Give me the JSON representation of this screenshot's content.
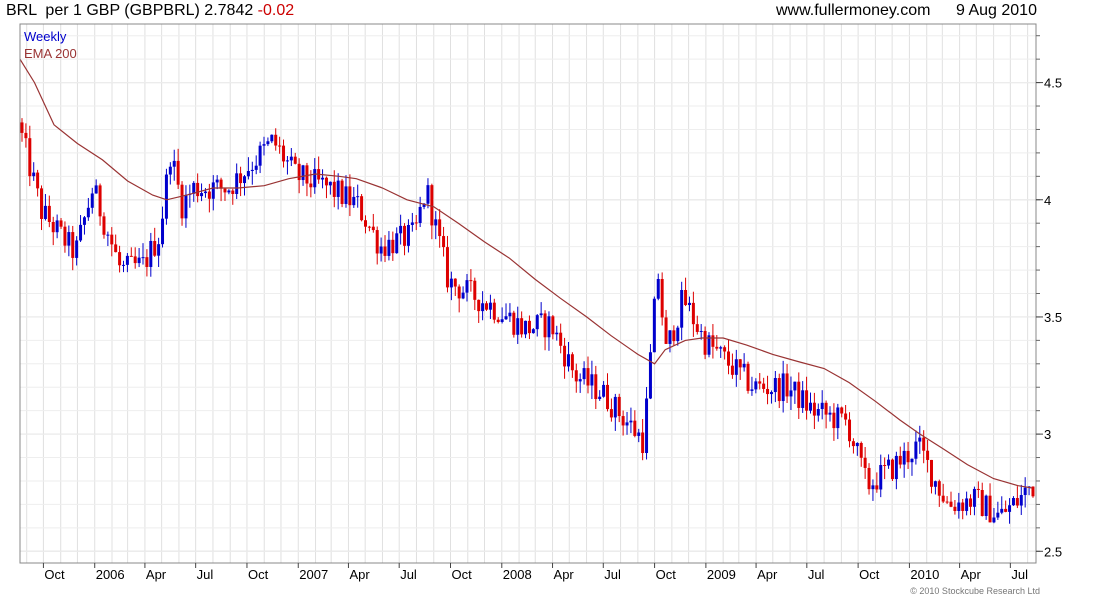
{
  "header": {
    "title": "BRL  per 1 GBP (GBPBRL) 2.7842",
    "change": " -0.02",
    "site": "www.fullermoney.com",
    "date": "9 Aug 2010"
  },
  "colors": {
    "up_candle": "#0000cc",
    "down_candle": "#dd0000",
    "ema_line": "#993333",
    "grid": "#cccccc",
    "frame": "#888888"
  },
  "copyright": "© 2010 Stockcube Research Ltd",
  "chart_data": {
    "type": "candlestick",
    "legend": [
      {
        "label": "Weekly",
        "color": "#0000cc"
      },
      {
        "label": "EMA 200",
        "color": "#993333"
      }
    ],
    "ylim": [
      2.45,
      4.75
    ],
    "y_ticks": [
      2.5,
      3,
      3.5,
      4,
      4.5
    ],
    "grid": true,
    "x_ticks": [
      "Oct",
      "2006",
      "Apr",
      "Jul",
      "Oct",
      "2007",
      "Apr",
      "Jul",
      "Oct",
      "2008",
      "Apr",
      "Jul",
      "Oct",
      "2009",
      "Apr",
      "Jul",
      "Oct",
      "2010",
      "Apr",
      "Jul"
    ],
    "x_range": [
      "2005-08-20",
      "2010-08-16"
    ],
    "series": [
      {
        "name": "Weekly",
        "kind": "candles",
        "anchors": [
          [
            "2005-08-20",
            4.33
          ],
          [
            "2005-10-01",
            3.95
          ],
          [
            "2005-12-01",
            3.77
          ],
          [
            "2006-01-01",
            4.05
          ],
          [
            "2006-02-20",
            3.7
          ],
          [
            "2006-04-01",
            3.72
          ],
          [
            "2006-05-01",
            3.85
          ],
          [
            "2006-05-20",
            4.2
          ],
          [
            "2006-06-10",
            3.98
          ],
          [
            "2006-07-01",
            4.05
          ],
          [
            "2006-09-01",
            4.05
          ],
          [
            "2006-11-20",
            4.25
          ],
          [
            "2007-01-01",
            4.1
          ],
          [
            "2007-03-01",
            4.05
          ],
          [
            "2007-04-20",
            3.98
          ],
          [
            "2007-06-01",
            3.8
          ],
          [
            "2007-08-01",
            3.85
          ],
          [
            "2007-08-22",
            4.05
          ],
          [
            "2007-10-01",
            3.65
          ],
          [
            "2007-12-15",
            3.55
          ],
          [
            "2008-02-15",
            3.45
          ],
          [
            "2008-04-01",
            3.47
          ],
          [
            "2008-05-15",
            3.25
          ],
          [
            "2008-07-01",
            3.18
          ],
          [
            "2008-09-15",
            2.97
          ],
          [
            "2008-10-10",
            3.7
          ],
          [
            "2008-10-25",
            3.35
          ],
          [
            "2008-11-25",
            3.58
          ],
          [
            "2009-01-01",
            3.4
          ],
          [
            "2009-02-15",
            3.3
          ],
          [
            "2009-04-01",
            3.2
          ],
          [
            "2009-06-01",
            3.2
          ],
          [
            "2009-07-15",
            3.1
          ],
          [
            "2009-09-15",
            3.05
          ],
          [
            "2009-10-20",
            2.78
          ],
          [
            "2009-12-01",
            2.85
          ],
          [
            "2010-01-20",
            2.95
          ],
          [
            "2010-02-20",
            2.8
          ],
          [
            "2010-03-15",
            2.7
          ],
          [
            "2010-05-01",
            2.72
          ],
          [
            "2010-06-15",
            2.65
          ],
          [
            "2010-07-20",
            2.72
          ],
          [
            "2010-08-09",
            2.78
          ]
        ]
      },
      {
        "name": "EMA 200",
        "kind": "line",
        "points": [
          [
            "2005-08-20",
            4.6
          ],
          [
            "2005-09-15",
            4.5
          ],
          [
            "2005-10-20",
            4.32
          ],
          [
            "2005-12-01",
            4.24
          ],
          [
            "2006-01-15",
            4.17
          ],
          [
            "2006-03-01",
            4.08
          ],
          [
            "2006-04-15",
            4.02
          ],
          [
            "2006-05-10",
            4.0
          ],
          [
            "2006-06-15",
            4.02
          ],
          [
            "2006-08-01",
            4.05
          ],
          [
            "2006-09-15",
            4.05
          ],
          [
            "2006-11-01",
            4.06
          ],
          [
            "2006-12-15",
            4.09
          ],
          [
            "2007-02-01",
            4.11
          ],
          [
            "2007-03-15",
            4.1
          ],
          [
            "2007-04-15",
            4.09
          ],
          [
            "2007-06-01",
            4.05
          ],
          [
            "2007-07-15",
            4.0
          ],
          [
            "2007-09-01",
            3.97
          ],
          [
            "2007-10-15",
            3.9
          ],
          [
            "2007-12-01",
            3.82
          ],
          [
            "2008-01-15",
            3.75
          ],
          [
            "2008-03-01",
            3.66
          ],
          [
            "2008-04-15",
            3.58
          ],
          [
            "2008-06-01",
            3.5
          ],
          [
            "2008-07-15",
            3.42
          ],
          [
            "2008-09-01",
            3.34
          ],
          [
            "2008-10-01",
            3.3
          ],
          [
            "2008-10-20",
            3.36
          ],
          [
            "2008-11-25",
            3.4
          ],
          [
            "2008-12-25",
            3.41
          ],
          [
            "2009-02-01",
            3.41
          ],
          [
            "2009-03-15",
            3.38
          ],
          [
            "2009-05-01",
            3.34
          ],
          [
            "2009-06-15",
            3.31
          ],
          [
            "2009-08-01",
            3.28
          ],
          [
            "2009-09-15",
            3.22
          ],
          [
            "2009-11-01",
            3.14
          ],
          [
            "2009-12-15",
            3.06
          ],
          [
            "2010-01-20",
            3.0
          ],
          [
            "2010-03-01",
            2.94
          ],
          [
            "2010-04-15",
            2.87
          ],
          [
            "2010-06-01",
            2.81
          ],
          [
            "2010-07-15",
            2.78
          ],
          [
            "2010-08-09",
            2.77
          ]
        ]
      }
    ]
  }
}
